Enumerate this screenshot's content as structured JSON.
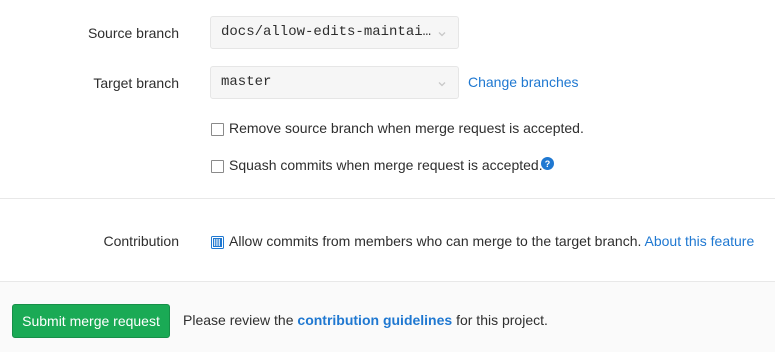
{
  "form": {
    "source_branch": {
      "label": "Source branch",
      "value": "docs/allow-edits-maintainers"
    },
    "target_branch": {
      "label": "Target branch",
      "value": "master",
      "change_link": "Change branches"
    },
    "remove_source_branch": {
      "label": "Remove source branch when merge request is accepted.",
      "checked": false
    },
    "squash_commits": {
      "label": "Squash commits when merge request is accepted.",
      "checked": false
    },
    "contribution": {
      "label": "Contribution",
      "checkbox_label": "Allow commits from members who can merge to the target branch.",
      "checked": true,
      "about_link": "About this feature"
    }
  },
  "footer": {
    "submit_label": "Submit merge request",
    "note_before": "Please review the",
    "note_link": "contribution guidelines",
    "note_after": "for this project."
  },
  "colors": {
    "accent_link": "#1f78d1",
    "submit_green": "#1aaa55",
    "checkbox_checked": "#1f78d1"
  }
}
